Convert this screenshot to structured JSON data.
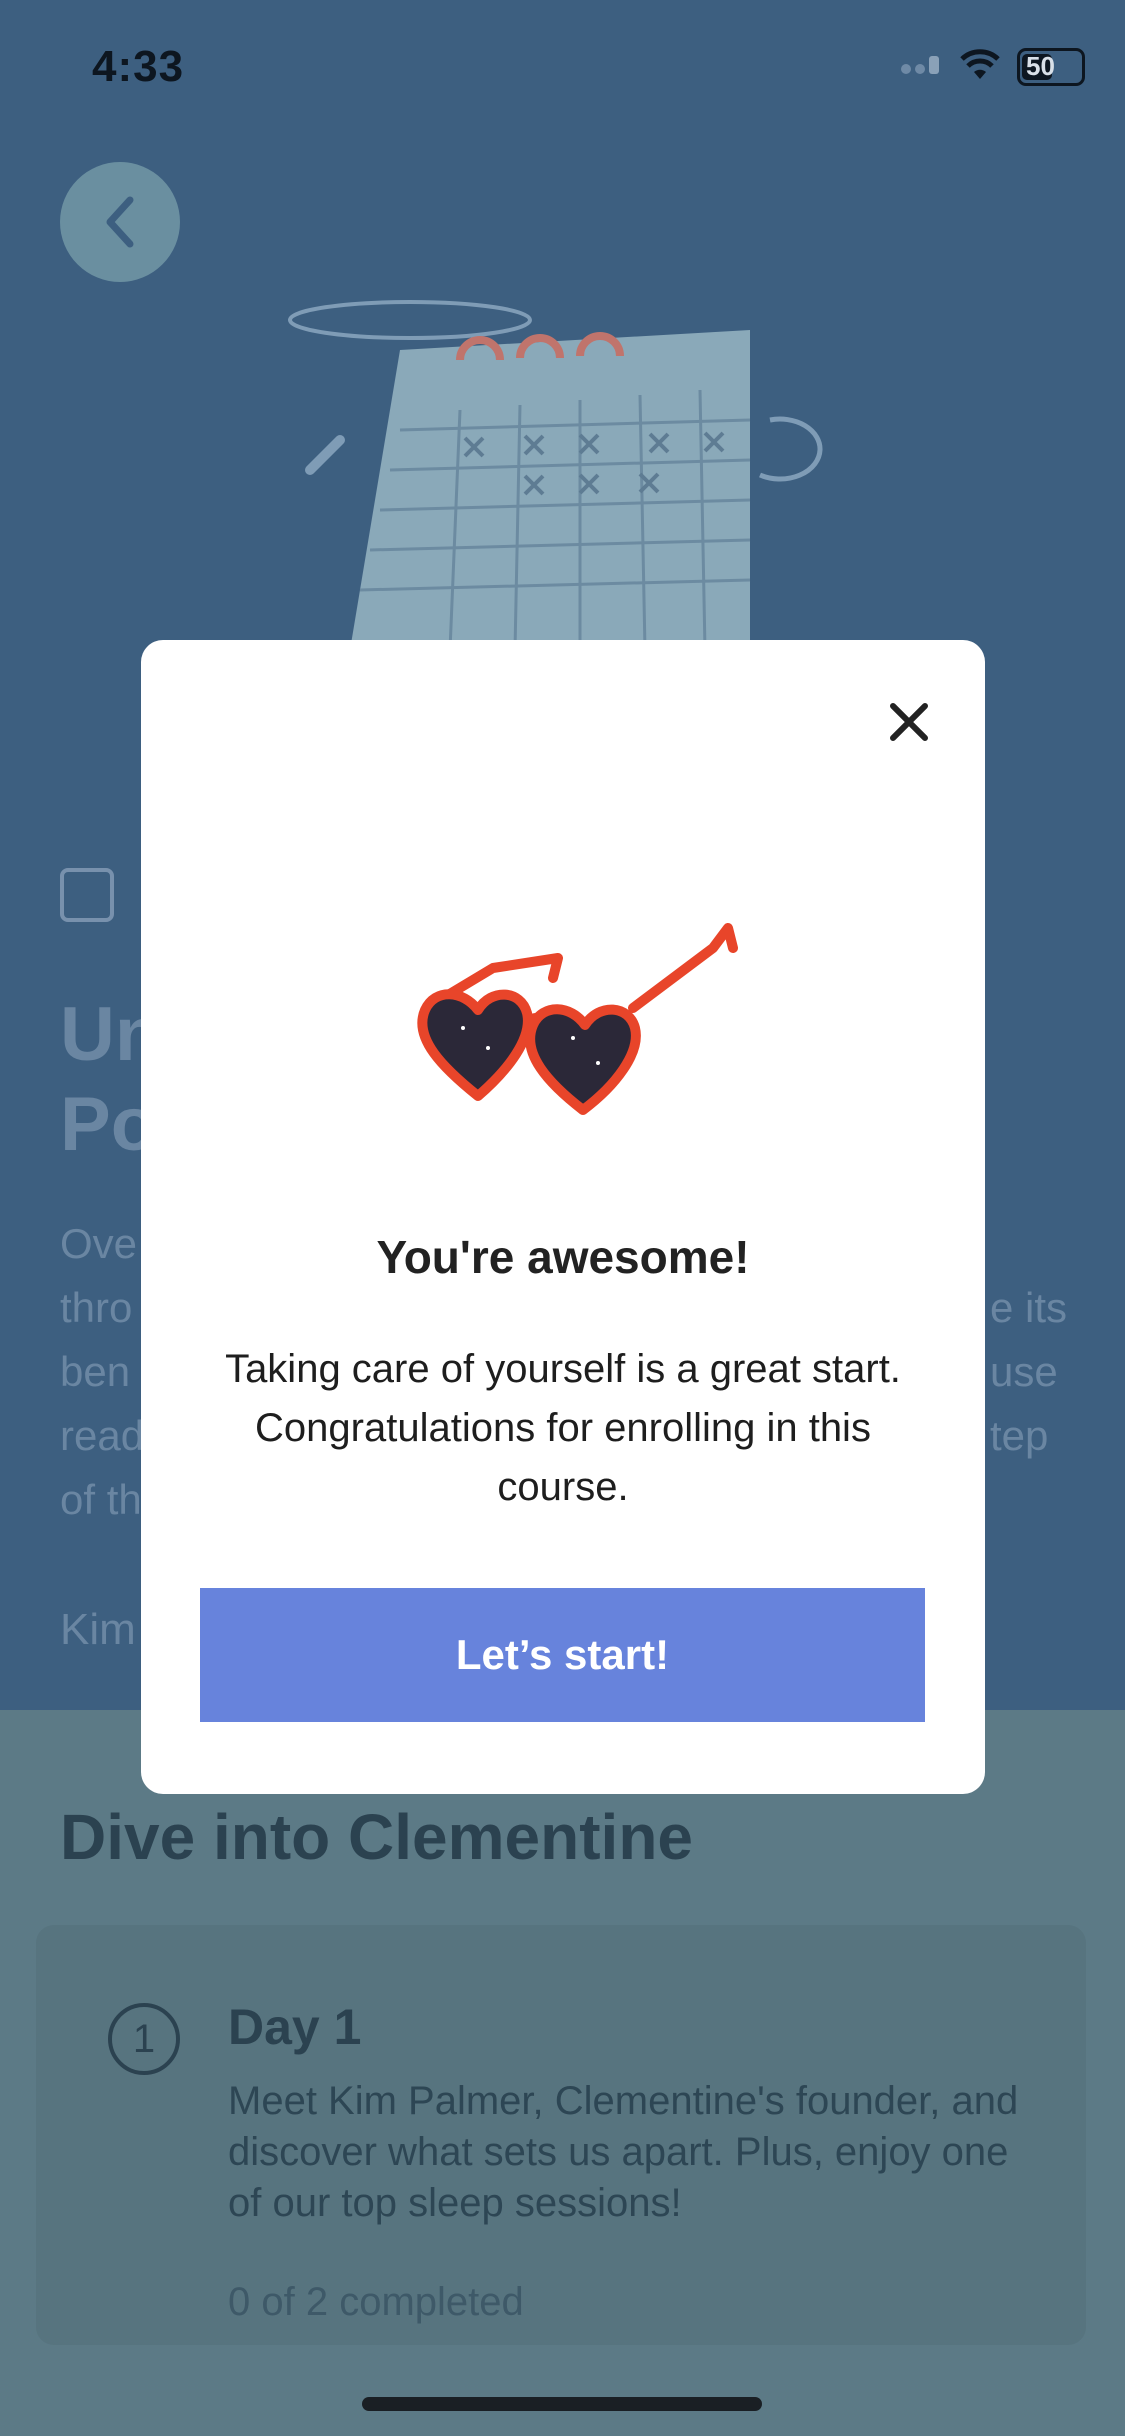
{
  "status_bar": {
    "time": "4:33",
    "battery": "50",
    "icons": [
      "signal-icon",
      "wifi-icon",
      "battery-icon"
    ]
  },
  "background": {
    "title_fragment_1": "Un",
    "title_fragment_2": "Po",
    "desc_left": [
      "Ove",
      "thro",
      "ben",
      "read",
      "of th"
    ],
    "desc_right": [
      "e its",
      "use",
      "tep"
    ],
    "author_fragment": "Kim",
    "section_title": "Dive into Clementine",
    "day": {
      "number": "1",
      "title": "Day 1",
      "description": "Meet Kim Palmer, Clementine's founder, and discover what sets us apart. Plus, enjoy one of our top sleep sessions!",
      "progress": "0 of 2 completed"
    }
  },
  "modal": {
    "title": "You're awesome!",
    "body": "Taking care of yourself is a great start. Congratulations for enrolling in this course.",
    "button_label": "Let’s start!",
    "illustration": "heart-sunglasses",
    "colors": {
      "button": "#6783dc",
      "glasses": "#e8452a"
    }
  }
}
